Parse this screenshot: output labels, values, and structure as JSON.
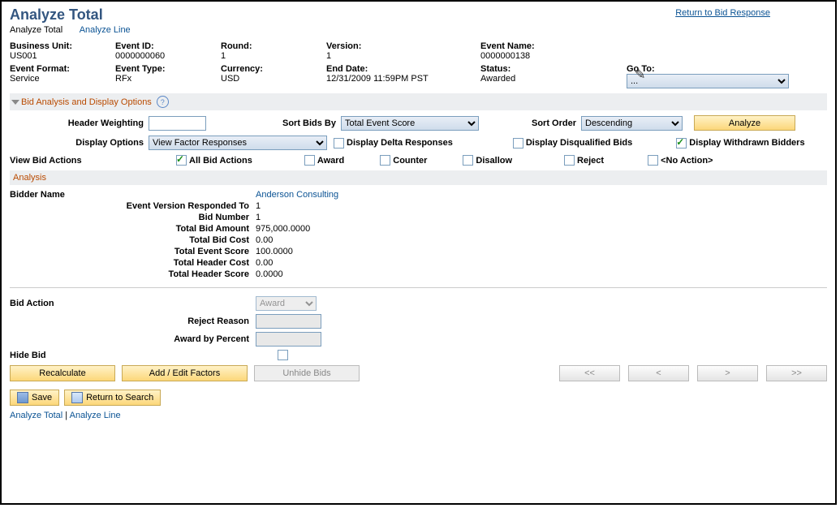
{
  "title": "Analyze Total",
  "top_link": "Return to Bid Response",
  "tabs": {
    "current": "Analyze Total",
    "other": "Analyze Line"
  },
  "fields_row1": {
    "business_unit": {
      "label": "Business Unit:",
      "value": "US001"
    },
    "event_id": {
      "label": "Event ID:",
      "value": "0000000060"
    },
    "round": {
      "label": "Round:",
      "value": "1"
    },
    "version": {
      "label": "Version:",
      "value": "1"
    },
    "event_name": {
      "label": "Event Name:",
      "value": "0000000138"
    }
  },
  "fields_row2": {
    "event_format": {
      "label": "Event Format:",
      "value": "Service"
    },
    "event_type": {
      "label": "Event Type:",
      "value": "RFx"
    },
    "currency": {
      "label": "Currency:",
      "value": "USD"
    },
    "end_date": {
      "label": "End Date:",
      "value": "12/31/2009 11:59PM PST"
    },
    "status": {
      "label": "Status:",
      "value": "Awarded"
    },
    "goto": {
      "label": "Go To:",
      "value": "..."
    }
  },
  "section_options": {
    "title": "Bid Analysis and Display Options",
    "header_weighting": {
      "label": "Header Weighting",
      "value": ""
    },
    "sort_bids": {
      "label": "Sort Bids By",
      "value": "Total Event Score"
    },
    "sort_order": {
      "label": "Sort Order",
      "value": "Descending"
    },
    "analyze_btn": "Analyze",
    "display_options": {
      "label": "Display Options",
      "value": "View Factor Responses"
    },
    "cb_delta": "Display Delta Responses",
    "cb_disq": "Display Disqualified Bids",
    "cb_withdrawn": "Display Withdrawn Bidders",
    "view_bid_actions_label": "View Bid Actions",
    "cb_all": "All Bid Actions",
    "cb_award": "Award",
    "cb_counter": "Counter",
    "cb_disallow": "Disallow",
    "cb_reject": "Reject",
    "cb_noaction": "<No Action>"
  },
  "analysis": {
    "section_title": "Analysis",
    "bidder_name_label": "Bidder Name",
    "bidder_link": "Anderson Consulting",
    "rows": [
      {
        "k": "Event Version Responded To",
        "v": "1"
      },
      {
        "k": "Bid Number",
        "v": "1"
      },
      {
        "k": "Total Bid Amount",
        "v": "975,000.0000"
      },
      {
        "k": "Total Bid Cost",
        "v": "0.00"
      },
      {
        "k": "Total Event Score",
        "v": "100.0000"
      },
      {
        "k": "Total Header Cost",
        "v": "0.00"
      },
      {
        "k": "Total Header Score",
        "v": "0.0000"
      }
    ]
  },
  "bid_action": {
    "label": "Bid Action",
    "select": "Award",
    "reject_reason": {
      "label": "Reject Reason",
      "value": ""
    },
    "award_percent": {
      "label": "Award by Percent",
      "value": ""
    },
    "hide_bid": {
      "label": "Hide Bid",
      "checked": false
    }
  },
  "buttons": {
    "recalculate": "Recalculate",
    "add_edit": "Add / Edit Factors",
    "unhide": "Unhide Bids",
    "nav_first": "<<",
    "nav_prev": "<",
    "nav_next": ">",
    "nav_last": ">>",
    "save": "Save",
    "return_search": "Return to Search"
  },
  "footer": {
    "analyze_total": "Analyze Total",
    "sep": " | ",
    "analyze_line": "Analyze Line"
  }
}
